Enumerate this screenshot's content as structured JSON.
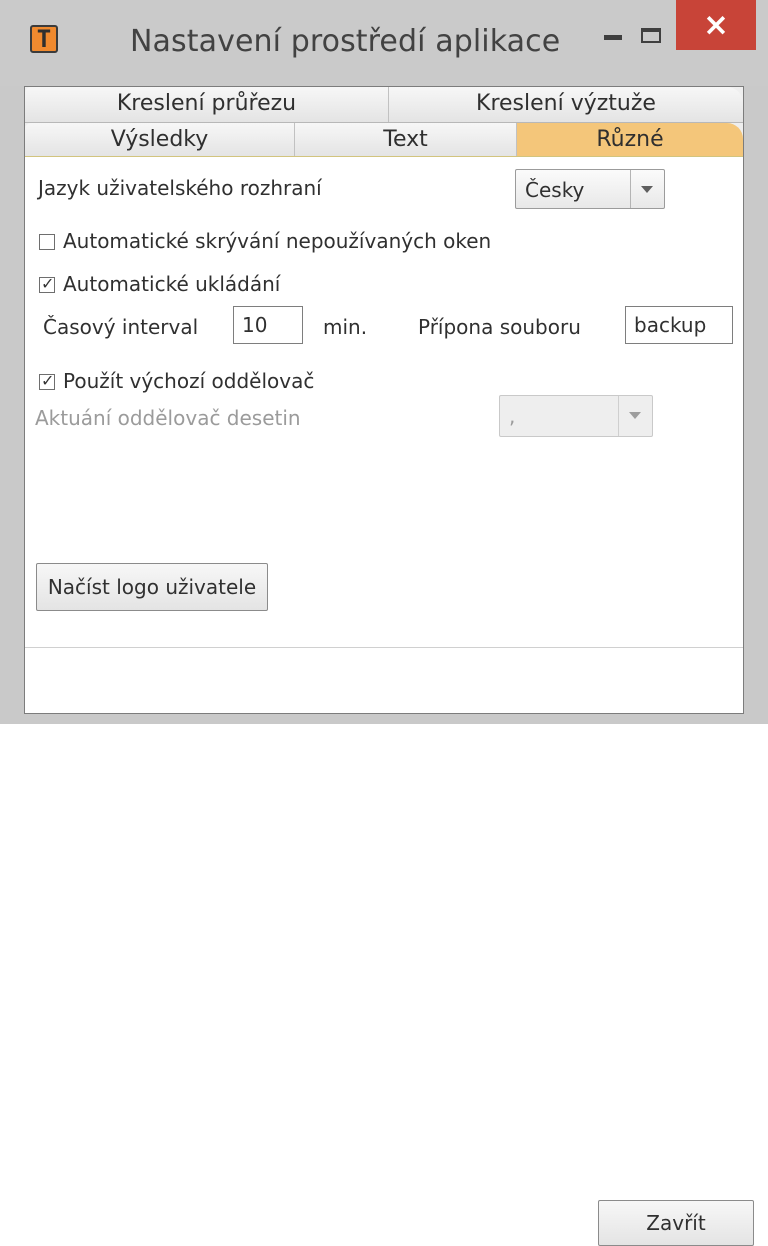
{
  "window": {
    "title": "Nastavení prostředí aplikace",
    "app_icon": "T",
    "close_icon": "×",
    "colors": {
      "titlebar": "#cacaca",
      "close_button": "#c84438",
      "selected_tab": "#f4c67a"
    }
  },
  "tabs": {
    "top": [
      {
        "label": "Kreslení průřezu"
      },
      {
        "label": "Kreslení výztuže"
      }
    ],
    "bottom": [
      {
        "label": "Výsledky"
      },
      {
        "label": "Text"
      },
      {
        "label": "Různé",
        "selected": true
      }
    ]
  },
  "settings": {
    "language": {
      "label": "Jazyk uživatelského rozhraní",
      "value": "Česky"
    },
    "auto_hide_windows": {
      "label": "Automatické skrývání nepoužívaných oken",
      "checked": false
    },
    "auto_save": {
      "label": "Automatické ukládání",
      "checked": true
    },
    "interval": {
      "label": "Časový interval",
      "value": "10",
      "unit": "min."
    },
    "file_extension": {
      "label": "Přípona souboru",
      "value": "backup"
    },
    "use_default_separator": {
      "label": "Použít výchozí oddělovač",
      "checked": true
    },
    "decimal_separator": {
      "label": "Aktuání oddělovač desetin",
      "value": ","
    },
    "load_logo_button": "Načíst logo uživatele"
  },
  "footer": {
    "close_button": "Zavřít"
  }
}
